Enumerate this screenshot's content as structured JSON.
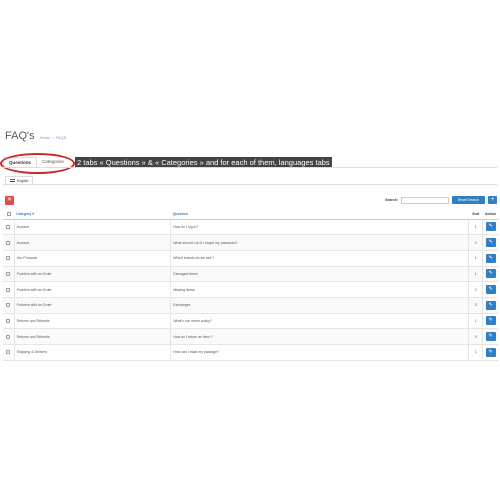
{
  "header": {
    "title": "FAQ's",
    "breadcrumb": [
      "Home",
      "FAQS"
    ]
  },
  "tabs": [
    {
      "label": "Questions",
      "active": true
    },
    {
      "label": "Categories",
      "active": false
    }
  ],
  "annotation": "2 tabs « Questions » & « Categories » and for each of them, languages tabs",
  "language_tabs": [
    {
      "label": "English",
      "flag": "uk-flag-icon"
    }
  ],
  "toolbar": {
    "delete_icon": "trash-icon",
    "search_label": "Search:",
    "search_value": "",
    "reset_label": "Reset Search",
    "add_icon": "plus-icon"
  },
  "table": {
    "headers": {
      "category": "Category",
      "question": "Question",
      "sort": "Sort",
      "action": "Action"
    },
    "rows": [
      {
        "category": "Account",
        "question": "How do I log in?",
        "sort": "1"
      },
      {
        "category": "Account",
        "question": "What should I do if I forget my password?",
        "sort": "2"
      },
      {
        "category": "Our Products",
        "question": "Which brands do we sell ?",
        "sort": "1"
      },
      {
        "category": "Problem with an Order",
        "question": "Damaged Items",
        "sort": "1"
      },
      {
        "category": "Problem with an Order",
        "question": "Missing Items",
        "sort": "2"
      },
      {
        "category": "Problem with an Order",
        "question": "Exchanges",
        "sort": "3"
      },
      {
        "category": "Returns and Refunds",
        "question": "What's our return policy?",
        "sort": "1"
      },
      {
        "category": "Returns and Refunds",
        "question": "How do I return an item ?",
        "sort": "0"
      },
      {
        "category": "Shipping & Delivery",
        "question": "How can I track my package?",
        "sort": "1"
      }
    ]
  },
  "colors": {
    "primary": "#2f7fc1",
    "danger": "#e04b4b",
    "highlight": "#c52b2b",
    "annotation_bg": "#444444"
  }
}
